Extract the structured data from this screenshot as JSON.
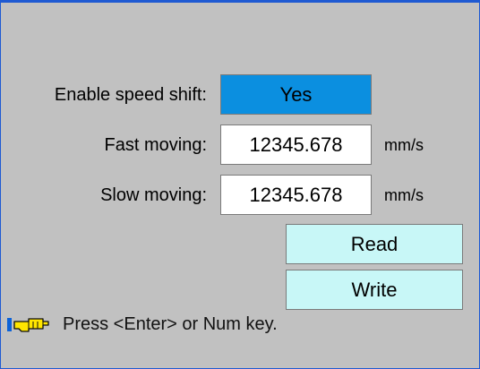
{
  "form": {
    "enable_speed_shift_label": "Enable speed shift:",
    "enable_speed_shift_value": "Yes",
    "fast_moving_label": "Fast moving:",
    "fast_moving_value": "12345.678",
    "fast_moving_unit": "mm/s",
    "slow_moving_label": "Slow moving:",
    "slow_moving_value": "12345.678",
    "slow_moving_unit": "mm/s"
  },
  "buttons": {
    "read_label": "Read",
    "write_label": "Write"
  },
  "hint": {
    "icon": "hand-pointing-icon",
    "text": "Press <Enter> or Num key."
  },
  "colors": {
    "background": "#c1c1c1",
    "frame": "#1f5ad2",
    "selected_field": "#0b8fe0",
    "input_field": "#ffffff",
    "action_button": "#c8f7f7"
  }
}
